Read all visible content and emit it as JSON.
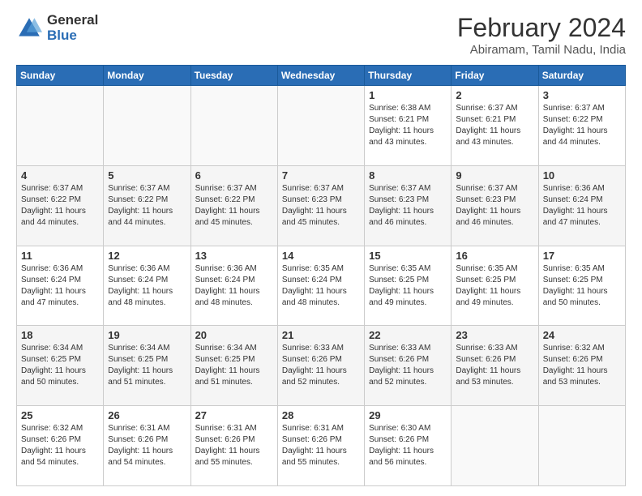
{
  "logo": {
    "general": "General",
    "blue": "Blue"
  },
  "header": {
    "title": "February 2024",
    "subtitle": "Abiramam, Tamil Nadu, India"
  },
  "days_of_week": [
    "Sunday",
    "Monday",
    "Tuesday",
    "Wednesday",
    "Thursday",
    "Friday",
    "Saturday"
  ],
  "weeks": [
    [
      {
        "day": "",
        "info": ""
      },
      {
        "day": "",
        "info": ""
      },
      {
        "day": "",
        "info": ""
      },
      {
        "day": "",
        "info": ""
      },
      {
        "day": "1",
        "info": "Sunrise: 6:38 AM\nSunset: 6:21 PM\nDaylight: 11 hours and 43 minutes."
      },
      {
        "day": "2",
        "info": "Sunrise: 6:37 AM\nSunset: 6:21 PM\nDaylight: 11 hours and 43 minutes."
      },
      {
        "day": "3",
        "info": "Sunrise: 6:37 AM\nSunset: 6:22 PM\nDaylight: 11 hours and 44 minutes."
      }
    ],
    [
      {
        "day": "4",
        "info": "Sunrise: 6:37 AM\nSunset: 6:22 PM\nDaylight: 11 hours and 44 minutes."
      },
      {
        "day": "5",
        "info": "Sunrise: 6:37 AM\nSunset: 6:22 PM\nDaylight: 11 hours and 44 minutes."
      },
      {
        "day": "6",
        "info": "Sunrise: 6:37 AM\nSunset: 6:22 PM\nDaylight: 11 hours and 45 minutes."
      },
      {
        "day": "7",
        "info": "Sunrise: 6:37 AM\nSunset: 6:23 PM\nDaylight: 11 hours and 45 minutes."
      },
      {
        "day": "8",
        "info": "Sunrise: 6:37 AM\nSunset: 6:23 PM\nDaylight: 11 hours and 46 minutes."
      },
      {
        "day": "9",
        "info": "Sunrise: 6:37 AM\nSunset: 6:23 PM\nDaylight: 11 hours and 46 minutes."
      },
      {
        "day": "10",
        "info": "Sunrise: 6:36 AM\nSunset: 6:24 PM\nDaylight: 11 hours and 47 minutes."
      }
    ],
    [
      {
        "day": "11",
        "info": "Sunrise: 6:36 AM\nSunset: 6:24 PM\nDaylight: 11 hours and 47 minutes."
      },
      {
        "day": "12",
        "info": "Sunrise: 6:36 AM\nSunset: 6:24 PM\nDaylight: 11 hours and 48 minutes."
      },
      {
        "day": "13",
        "info": "Sunrise: 6:36 AM\nSunset: 6:24 PM\nDaylight: 11 hours and 48 minutes."
      },
      {
        "day": "14",
        "info": "Sunrise: 6:35 AM\nSunset: 6:24 PM\nDaylight: 11 hours and 48 minutes."
      },
      {
        "day": "15",
        "info": "Sunrise: 6:35 AM\nSunset: 6:25 PM\nDaylight: 11 hours and 49 minutes."
      },
      {
        "day": "16",
        "info": "Sunrise: 6:35 AM\nSunset: 6:25 PM\nDaylight: 11 hours and 49 minutes."
      },
      {
        "day": "17",
        "info": "Sunrise: 6:35 AM\nSunset: 6:25 PM\nDaylight: 11 hours and 50 minutes."
      }
    ],
    [
      {
        "day": "18",
        "info": "Sunrise: 6:34 AM\nSunset: 6:25 PM\nDaylight: 11 hours and 50 minutes."
      },
      {
        "day": "19",
        "info": "Sunrise: 6:34 AM\nSunset: 6:25 PM\nDaylight: 11 hours and 51 minutes."
      },
      {
        "day": "20",
        "info": "Sunrise: 6:34 AM\nSunset: 6:25 PM\nDaylight: 11 hours and 51 minutes."
      },
      {
        "day": "21",
        "info": "Sunrise: 6:33 AM\nSunset: 6:26 PM\nDaylight: 11 hours and 52 minutes."
      },
      {
        "day": "22",
        "info": "Sunrise: 6:33 AM\nSunset: 6:26 PM\nDaylight: 11 hours and 52 minutes."
      },
      {
        "day": "23",
        "info": "Sunrise: 6:33 AM\nSunset: 6:26 PM\nDaylight: 11 hours and 53 minutes."
      },
      {
        "day": "24",
        "info": "Sunrise: 6:32 AM\nSunset: 6:26 PM\nDaylight: 11 hours and 53 minutes."
      }
    ],
    [
      {
        "day": "25",
        "info": "Sunrise: 6:32 AM\nSunset: 6:26 PM\nDaylight: 11 hours and 54 minutes."
      },
      {
        "day": "26",
        "info": "Sunrise: 6:31 AM\nSunset: 6:26 PM\nDaylight: 11 hours and 54 minutes."
      },
      {
        "day": "27",
        "info": "Sunrise: 6:31 AM\nSunset: 6:26 PM\nDaylight: 11 hours and 55 minutes."
      },
      {
        "day": "28",
        "info": "Sunrise: 6:31 AM\nSunset: 6:26 PM\nDaylight: 11 hours and 55 minutes."
      },
      {
        "day": "29",
        "info": "Sunrise: 6:30 AM\nSunset: 6:26 PM\nDaylight: 11 hours and 56 minutes."
      },
      {
        "day": "",
        "info": ""
      },
      {
        "day": "",
        "info": ""
      }
    ]
  ]
}
